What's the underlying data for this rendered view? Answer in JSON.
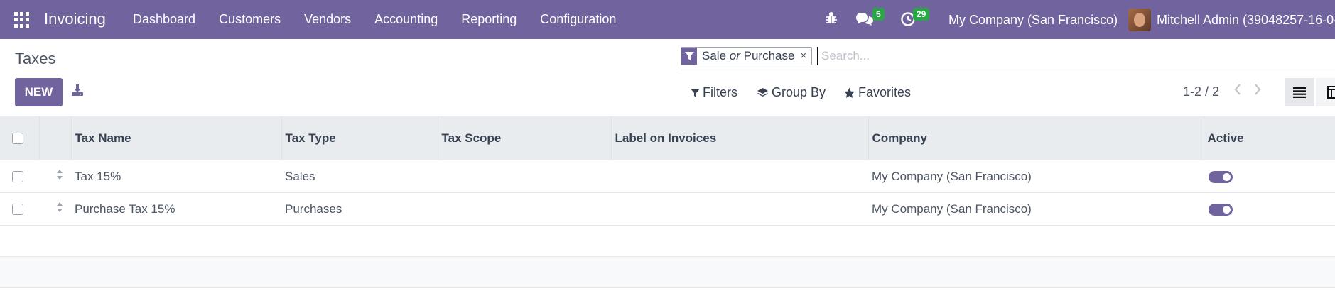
{
  "navbar": {
    "app_title": "Invoicing",
    "menu": [
      "Dashboard",
      "Customers",
      "Vendors",
      "Accounting",
      "Reporting",
      "Configuration"
    ],
    "messages_count": "5",
    "activities_count": "29",
    "company": "My Company (San Francisco)",
    "user": "Mitchell Admin (39048257-16-0-"
  },
  "control_panel": {
    "breadcrumb": "Taxes",
    "new_label": "NEW",
    "search": {
      "facet_part1": "Sale",
      "facet_or": "or",
      "facet_part2": "Purchase",
      "facet_remove": "×",
      "placeholder": "Search..."
    },
    "filters_label": "Filters",
    "group_by_label": "Group By",
    "favorites_label": "Favorites",
    "pager": "1-2 / 2"
  },
  "table": {
    "columns": [
      "Tax Name",
      "Tax Type",
      "Tax Scope",
      "Label on Invoices",
      "Company",
      "Active"
    ],
    "rows": [
      {
        "name": "Tax 15%",
        "type": "Sales",
        "scope": "",
        "label": "",
        "company": "My Company (San Francisco)",
        "active": true
      },
      {
        "name": "Purchase Tax 15%",
        "type": "Purchases",
        "scope": "",
        "label": "",
        "company": "My Company (San Francisco)",
        "active": true
      }
    ]
  },
  "colors": {
    "brand": "#71639e",
    "badge": "#28a745",
    "header_bg": "#e9ecef"
  },
  "icons": [
    "apps-grid-icon",
    "bug-icon",
    "chat-icon",
    "clock-icon",
    "download-icon",
    "filter-icon",
    "layers-icon",
    "star-icon",
    "list-view-icon",
    "kanban-view-icon",
    "chevron-left-icon",
    "chevron-right-icon"
  ]
}
